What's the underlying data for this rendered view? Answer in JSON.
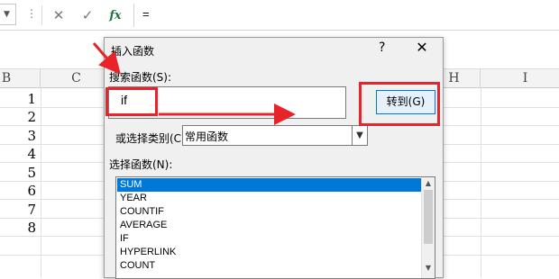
{
  "formula_bar": {
    "more_glyph": "⋮",
    "cancel_glyph": "✕",
    "enter_glyph": "✓",
    "fx_glyph": "fx",
    "formula": "="
  },
  "columns": [
    "B",
    "C",
    "H",
    "I"
  ],
  "rows": [
    "1",
    "2",
    "3",
    "4",
    "5",
    "6",
    "7",
    "8"
  ],
  "dialog": {
    "title": "插入函数",
    "help": "?",
    "close": "✕",
    "search_label": "搜索函数(S):",
    "search_value": "if",
    "goto_label": "转到(G)",
    "category_label": "或选择类别(C):",
    "category_value": "常用函数",
    "function_label": "选择函数(N):",
    "functions": [
      "SUM",
      "YEAR",
      "COUNTIF",
      "AVERAGE",
      "IF",
      "HYPERLINK",
      "COUNT"
    ],
    "selected_function": "SUM"
  },
  "colors": {
    "annotation": "#e8232a",
    "selection": "#0078d7",
    "dialog_bg": "#f0f0f0"
  }
}
